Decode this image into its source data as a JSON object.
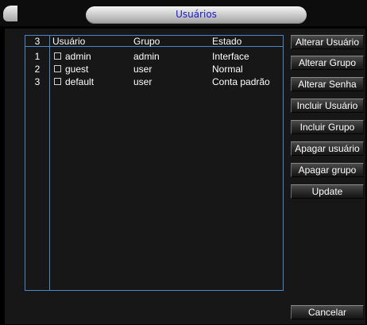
{
  "window": {
    "title": "Usuários"
  },
  "table": {
    "count": "3",
    "columns": [
      "Usuário",
      "Grupo",
      "Estado"
    ],
    "rows": [
      {
        "index": "1",
        "user": "admin",
        "group": "admin",
        "status": "Interface"
      },
      {
        "index": "2",
        "user": "guest",
        "group": "user",
        "status": "Normal"
      },
      {
        "index": "3",
        "user": "default",
        "group": "user",
        "status": "Conta padrão"
      }
    ]
  },
  "buttons": {
    "alter_user": "Alterar Usuário",
    "alter_group": "Alterar Grupo",
    "alter_password": "Alterar Senha",
    "add_user": "Incluir Usuário",
    "add_group": "Incluir Grupo",
    "delete_user": "Apagar usuário",
    "delete_group": "Apagar grupo",
    "update": "Update",
    "cancel": "Cancelar"
  },
  "colors": {
    "accent_border": "#4a87c8",
    "title_text": "#1a1acc",
    "background": "#000000"
  }
}
